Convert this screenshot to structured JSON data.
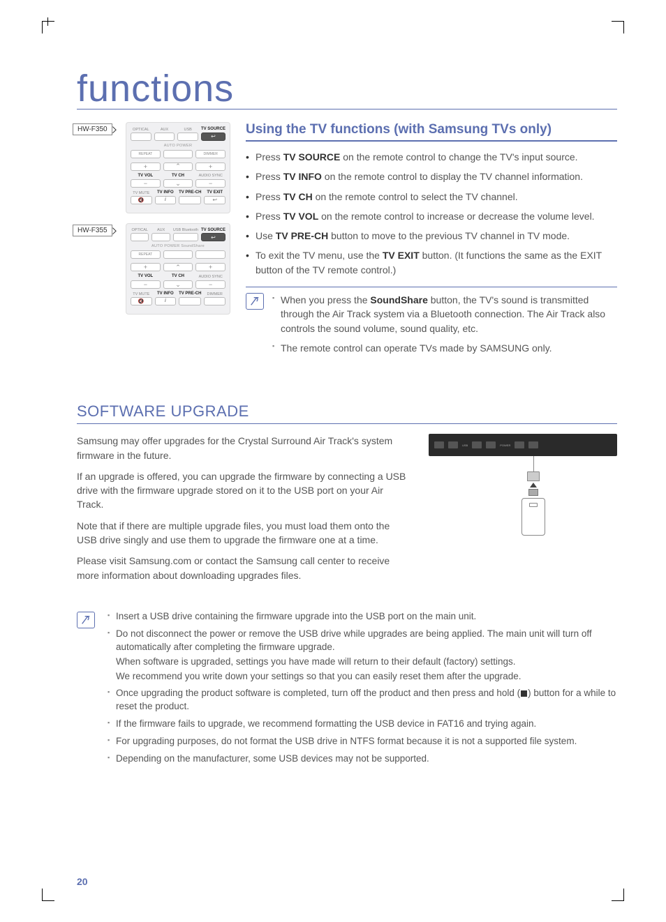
{
  "page": {
    "title": "functions",
    "number": "20"
  },
  "remotes": {
    "models": [
      "HW-F350",
      "HW-F355"
    ],
    "f350": {
      "row1_labels": [
        "OPTICAL",
        "AUX",
        "USB",
        "TV SOURCE"
      ],
      "sub1": "AUTO POWER",
      "row2_labels": [
        "REPEAT",
        "",
        "DIMMER"
      ],
      "row3_labels": [
        "TV VOL",
        "TV CH",
        "AUDIO SYNC"
      ],
      "row4_labels": [
        "TV MUTE",
        "TV INFO",
        "TV PRE-CH",
        "TV EXIT"
      ]
    },
    "f355": {
      "row1_labels": [
        "OPTICAL",
        "AUX",
        "USB Bluetooth",
        "TV SOURCE"
      ],
      "sub1": "AUTO POWER  SoundShare",
      "row2_labels": [
        "REPEAT",
        "",
        ""
      ],
      "row3_labels": [
        "TV VOL",
        "TV CH",
        "AUDIO SYNC"
      ],
      "row4_labels": [
        "TV MUTE",
        "TV INFO",
        "TV PRE-CH",
        "DIMMER"
      ]
    }
  },
  "tv_section": {
    "heading": "Using the TV functions (with Samsung TVs only)",
    "bullets": [
      {
        "pre": "Press ",
        "bold": "TV SOURCE",
        "post": " on the remote control to change the TV's input source."
      },
      {
        "pre": "Press ",
        "bold": "TV INFO",
        "post": " on the remote control to display the TV channel information."
      },
      {
        "pre": "Press ",
        "bold": "TV CH",
        "post": " on the remote control to select the TV channel."
      },
      {
        "pre": "Press ",
        "bold": "TV VOL",
        "post": " on the remote control to increase or decrease the volume level."
      },
      {
        "pre": "Use ",
        "bold": "TV PRE-CH",
        "post": " button to move to the previous TV channel in TV mode."
      },
      {
        "pre": "To exit the TV menu, use the ",
        "bold": "TV EXIT",
        "post": " button. (It functions the same as the EXIT button of the TV remote control.)"
      }
    ],
    "notes": [
      {
        "pre": "When you press the ",
        "bold": "SoundShare",
        "post": " button, the TV's sound is transmitted through the Air Track system via a Bluetooth connection. The Air Track also controls the sound volume, sound quality, etc."
      },
      {
        "text": "The remote control can operate TVs made by SAMSUNG only."
      }
    ]
  },
  "sw_section": {
    "heading": "SOFTWARE UPGRADE",
    "paragraphs": [
      "Samsung may offer upgrades for the Crystal Surround Air Track's system firmware in the future.",
      "If an upgrade is offered, you can upgrade the firmware by connecting a USB drive with the firmware upgrade stored on it to the USB port on your Air Track.",
      "Note that if there are multiple upgrade files, you must load them onto the USB drive singly and use them to upgrade the firmware one at a time.",
      "Please visit Samsung.com or contact the Samsung call center to receive more information about downloading upgrades files."
    ],
    "diagram_labels": {
      "power": "POWER",
      "usb": "USB"
    },
    "notes": [
      "Insert a USB drive containing the firmware upgrade into the USB port on the main unit.",
      "Do not disconnect the power or remove the USB drive while upgrades are being applied. The main unit will turn off automatically after completing the firmware upgrade.",
      "Once upgrading the product software is completed, turn off the product and then press and hold (■) button for a while to reset the product.",
      "If the firmware fails to upgrade, we recommend formatting the USB device in FAT16 and trying again.",
      "For upgrading purposes, do not format the USB drive in NTFS format because it is not a supported file system.",
      "Depending on the manufacturer, some USB devices may not be supported."
    ],
    "note_sub": [
      "When software is upgraded, settings you have made will return to their default (factory) settings.",
      "We recommend you write down your settings so that you can easily reset them after the upgrade."
    ]
  }
}
